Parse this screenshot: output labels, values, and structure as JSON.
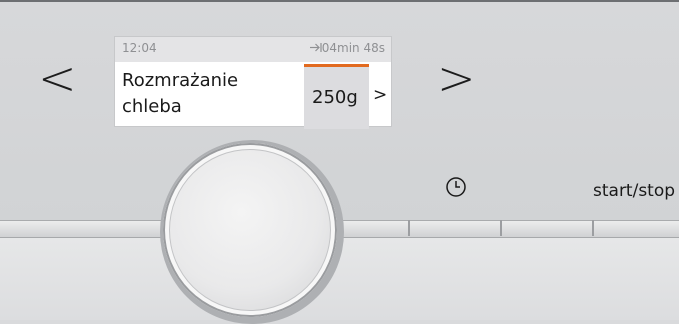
{
  "display": {
    "time": "12:04",
    "remaining_icon": "skip-to-end-icon",
    "remaining_time": "04min 48s",
    "program_name": "Rozmrażanie chleba",
    "weight": "250g",
    "weight_chevron": ">"
  },
  "controls": {
    "prev_arrow": "<",
    "next_arrow": ">",
    "timer_icon": "clock-icon",
    "start_stop_label": "start/stop"
  },
  "colors": {
    "accent": "#e26a1f",
    "panel": "#d7d8da",
    "screen_bg": "#ffffff",
    "status_bar": "#e4e4e6"
  }
}
